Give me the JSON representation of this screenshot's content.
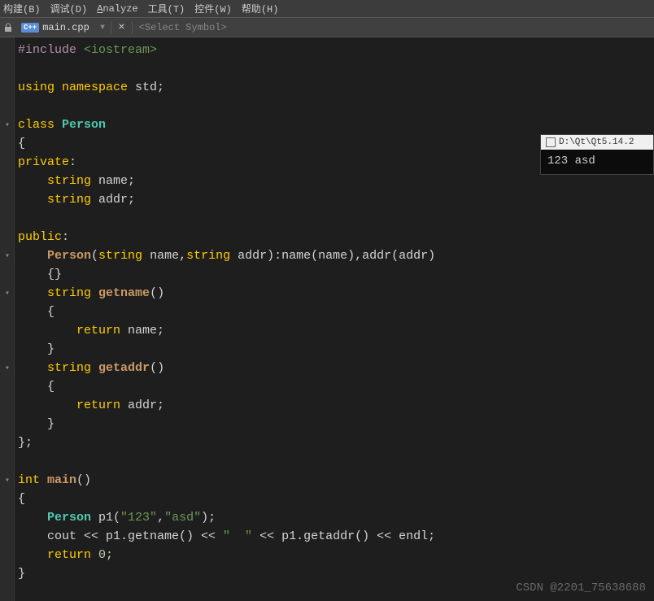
{
  "menu": {
    "build": "构建(B)",
    "debug": "调试(D)",
    "analyze": "Analyze",
    "tools": "工具(T)",
    "widgets": "控件(W)",
    "help": "帮助(H)"
  },
  "tab": {
    "filename": "main.cpp",
    "symbol_placeholder": "<Select Symbol>"
  },
  "code": {
    "l1a": "#include ",
    "l1b": "<iostream>",
    "l3a": "using ",
    "l3b": "namespace ",
    "l3c": "std",
    "l3d": ";",
    "l5a": "class ",
    "l5b": "Person",
    "l6": "{",
    "l7a": "private",
    "l7b": ":",
    "l8a": "    ",
    "l8b": "string",
    "l8c": " name;",
    "l9a": "    ",
    "l9b": "string",
    "l9c": " addr;",
    "l11a": "public",
    "l11b": ":",
    "l12a": "    ",
    "l12b": "Person",
    "l12c": "(",
    "l12d": "string",
    "l12e": " name,",
    "l12f": "string",
    "l12g": " addr):name(name),addr(addr)",
    "l13": "    {}",
    "l14a": "    ",
    "l14b": "string",
    "l14c": " ",
    "l14d": "getname",
    "l14e": "()",
    "l15": "    {",
    "l16a": "        ",
    "l16b": "return",
    "l16c": " name;",
    "l17": "    }",
    "l18a": "    ",
    "l18b": "string",
    "l18c": " ",
    "l18d": "getaddr",
    "l18e": "()",
    "l19": "    {",
    "l20a": "        ",
    "l20b": "return",
    "l20c": " addr;",
    "l21": "    }",
    "l22": "};",
    "l24a": "int ",
    "l24b": "main",
    "l24c": "()",
    "l25": "{",
    "l26a": "    ",
    "l26b": "Person",
    "l26c": " p1(",
    "l26d": "\"123\"",
    "l26e": ",",
    "l26f": "\"asd\"",
    "l26g": ");",
    "l27a": "    cout << p1.getname() << ",
    "l27b": "\"  \"",
    "l27c": " << p1.getaddr() << endl;",
    "l28a": "    ",
    "l28b": "return ",
    "l28c": "0",
    "l28d": ";",
    "l29": "}"
  },
  "console": {
    "title": "D:\\Qt\\Qt5.14.2",
    "output": "123  asd"
  },
  "watermark": "CSDN @2201_75638688",
  "icons": {
    "cpp_badge": "C++",
    "dropdown": "▾",
    "close": "×",
    "fold": "▾"
  }
}
